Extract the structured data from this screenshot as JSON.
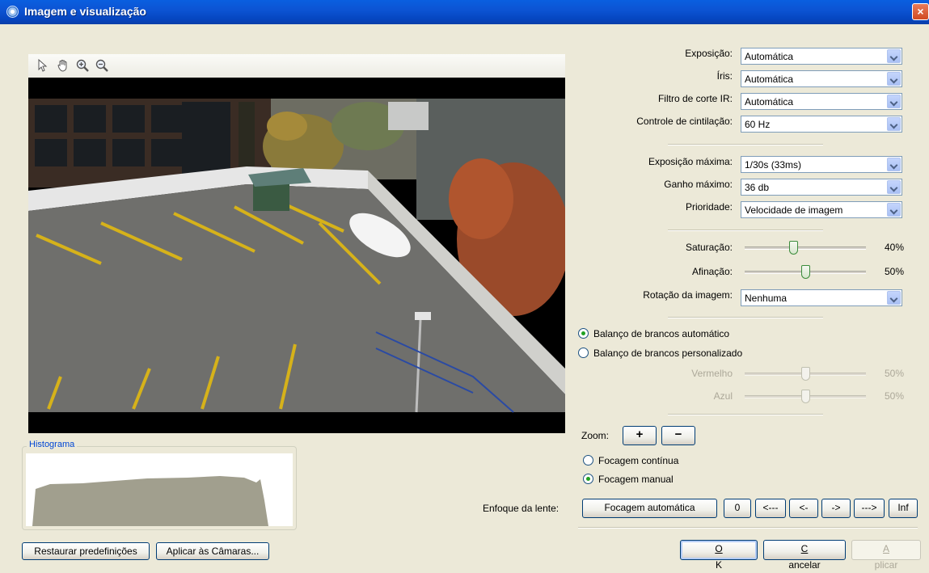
{
  "window": {
    "title": "Imagem e visualização",
    "close_glyph": "×"
  },
  "toolbar": {
    "tools": [
      {
        "name": "pointer-tool-icon"
      },
      {
        "name": "pan-hand-tool-icon"
      },
      {
        "name": "zoom-in-tool-icon"
      },
      {
        "name": "zoom-out-tool-icon"
      }
    ]
  },
  "histogram": {
    "label": "Histograma"
  },
  "settings": {
    "exposure": {
      "label": "Exposição:",
      "value": "Automática"
    },
    "iris": {
      "label": "Íris:",
      "value": "Automática"
    },
    "ir_filter": {
      "label": "Filtro de corte IR:",
      "value": "Automática"
    },
    "flicker": {
      "label": "Controle de cintilação:",
      "value": "60 Hz"
    },
    "max_exposure": {
      "label": "Exposição máxima:",
      "value": "1/30s (33ms)"
    },
    "max_gain": {
      "label": "Ganho máximo:",
      "value": "36 db"
    },
    "priority": {
      "label": "Prioridade:",
      "value": "Velocidade de imagem"
    },
    "saturation": {
      "label": "Saturação:",
      "value": 0.4,
      "display": "40%"
    },
    "sharpness": {
      "label": "Afinação:",
      "value": 0.5,
      "display": "50%"
    },
    "rotation": {
      "label": "Rotação da imagem:",
      "value": "Nenhuma"
    },
    "wb_auto": {
      "label": "Balanço de brancos automático",
      "checked": true
    },
    "wb_custom": {
      "label": "Balanço de brancos personalizado",
      "checked": false
    },
    "red": {
      "label": "Vermelho",
      "value": 0.5,
      "display": "50%"
    },
    "blue": {
      "label": "Azul",
      "value": 0.5,
      "display": "50%"
    }
  },
  "zoom": {
    "label": "Zoom:",
    "plus": "+",
    "minus": "−"
  },
  "focus": {
    "continuous": {
      "label": "Focagem contínua",
      "checked": false
    },
    "manual": {
      "label": "Focagem manual",
      "checked": true
    },
    "lens_label": "Enfoque da lente:",
    "autofocus": "Focagem automática",
    "steps": [
      "0",
      "<---",
      "<-",
      "->",
      "--->",
      "Inf"
    ]
  },
  "footer": {
    "restore": "Restaurar predefinições",
    "apply_cameras": "Aplicar às Câmaras...",
    "ok_u": "O",
    "ok_rest": "K",
    "cancel_u": "C",
    "cancel_rest": "ancelar",
    "apply_u": "A",
    "apply_rest": "plicar"
  },
  "colors": {
    "title_bar": "#0b58d6",
    "group_label": "#0046d5",
    "check_green": "#21a121"
  }
}
